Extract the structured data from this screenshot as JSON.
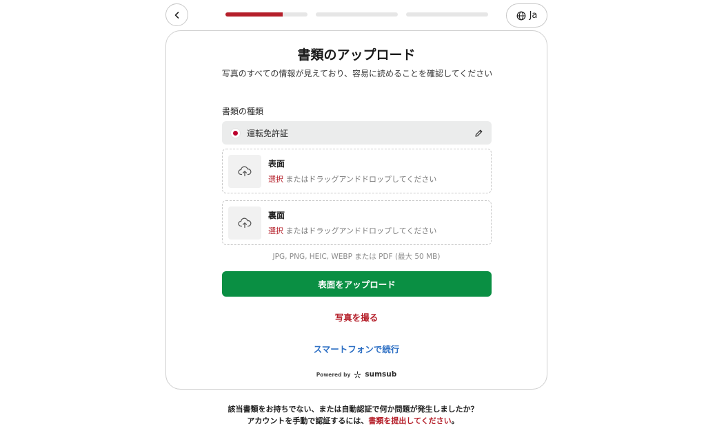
{
  "header": {
    "language_label": "Ja",
    "progress": [
      0.7,
      0,
      0
    ],
    "accent_color": "#b51f2a"
  },
  "card": {
    "title": "書類のアップロード",
    "subtitle": "写真のすべての情報が見えており、容易に読めることを確認してください",
    "doc_type_label": "書類の種類",
    "doc_type_value": "運転免許証",
    "uploads": [
      {
        "side": "表面",
        "select": "選択",
        "hint": " またはドラッグアンドドロップしてください"
      },
      {
        "side": "裏面",
        "select": "選択",
        "hint": " またはドラッグアンドドロップしてください"
      }
    ],
    "formats": "JPG, PNG, HEIC, WEBP または PDF (最大 50 MB)",
    "primary_button": "表面をアップロード",
    "primary_color": "#0a8f43",
    "photo_link": "写真を撮る",
    "phone_link": "スマートフォンで続行",
    "powered_by": "Powered by",
    "brand": "sumsub"
  },
  "footer": {
    "line1": "該当書類をお持ちでない、または自動認証で何か問題が発生しましたか？",
    "line2_prefix": "アカウントを手動で認証するには、",
    "line2_link": "書類を提出してください",
    "line2_suffix": "。"
  }
}
